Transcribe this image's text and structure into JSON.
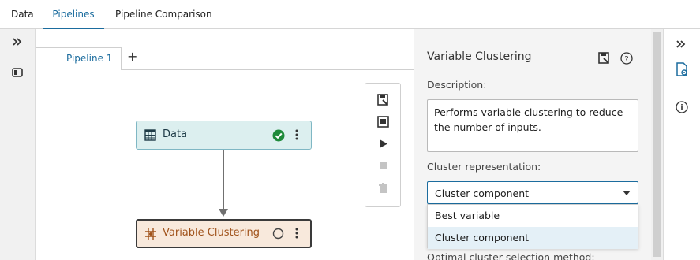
{
  "tabs": [
    {
      "label": "Data",
      "active": false
    },
    {
      "label": "Pipelines",
      "active": true
    },
    {
      "label": "Pipeline Comparison",
      "active": false
    }
  ],
  "left_rail": {
    "expand_icon": "double-chevron-right-icon",
    "panel_icon": "panel-toggle-icon"
  },
  "canvas": {
    "pipeline_tab": "Pipeline 1",
    "add_tab_symbol": "+",
    "nodes": [
      {
        "label": "Data",
        "status": "complete",
        "icon": "data-table-icon"
      },
      {
        "label": "Variable Clustering",
        "status": "not-run",
        "icon": "clustering-icon"
      }
    ],
    "toolbar_icons": [
      "save-icon",
      "stop-icon",
      "run-icon",
      "pause-icon",
      "delete-icon"
    ]
  },
  "properties": {
    "title": "Variable Clustering",
    "description_label": "Description:",
    "description_text": "Performs variable clustering to reduce the number of inputs.",
    "cluster_rep_label": "Cluster representation:",
    "cluster_rep_value": "Cluster component",
    "options": [
      {
        "label": "Best variable",
        "selected": false
      },
      {
        "label": "Cluster component",
        "selected": true
      }
    ],
    "next_label": "Optimal cluster selection method:"
  },
  "right_rail": {
    "expand_icon": "double-chevron-right-icon",
    "icons": [
      "node-properties-icon",
      "info-icon"
    ]
  },
  "colors": {
    "accent": "#1b6c9e",
    "data_node_bg": "#dcefef",
    "vc_node_bg": "#f8e9dc",
    "success": "#1e8a3a"
  }
}
